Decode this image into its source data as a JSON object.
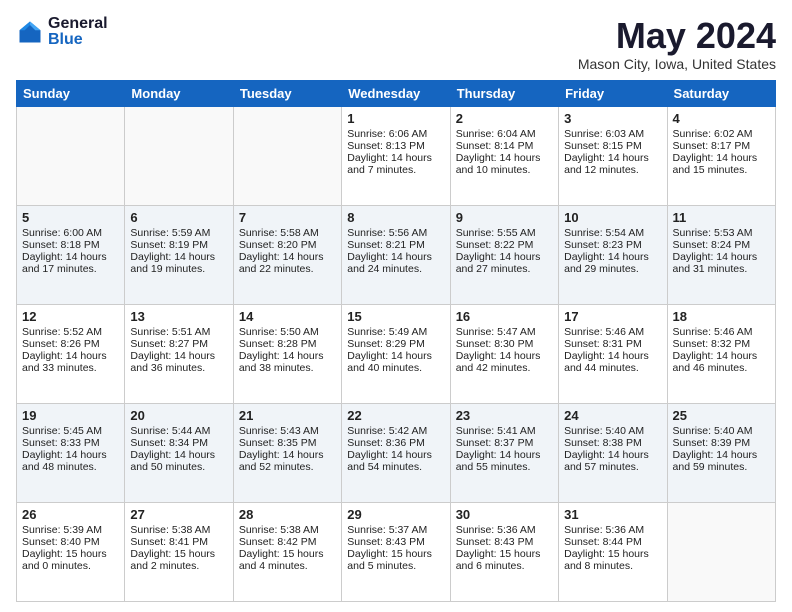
{
  "header": {
    "logo_general": "General",
    "logo_blue": "Blue",
    "title": "May 2024",
    "location": "Mason City, Iowa, United States"
  },
  "days_of_week": [
    "Sunday",
    "Monday",
    "Tuesday",
    "Wednesday",
    "Thursday",
    "Friday",
    "Saturday"
  ],
  "weeks": [
    [
      {
        "day": "",
        "sunrise": "",
        "sunset": "",
        "daylight": "",
        "empty": true
      },
      {
        "day": "",
        "sunrise": "",
        "sunset": "",
        "daylight": "",
        "empty": true
      },
      {
        "day": "",
        "sunrise": "",
        "sunset": "",
        "daylight": "",
        "empty": true
      },
      {
        "day": "1",
        "sunrise": "Sunrise: 6:06 AM",
        "sunset": "Sunset: 8:13 PM",
        "daylight": "Daylight: 14 hours and 7 minutes."
      },
      {
        "day": "2",
        "sunrise": "Sunrise: 6:04 AM",
        "sunset": "Sunset: 8:14 PM",
        "daylight": "Daylight: 14 hours and 10 minutes."
      },
      {
        "day": "3",
        "sunrise": "Sunrise: 6:03 AM",
        "sunset": "Sunset: 8:15 PM",
        "daylight": "Daylight: 14 hours and 12 minutes."
      },
      {
        "day": "4",
        "sunrise": "Sunrise: 6:02 AM",
        "sunset": "Sunset: 8:17 PM",
        "daylight": "Daylight: 14 hours and 15 minutes."
      }
    ],
    [
      {
        "day": "5",
        "sunrise": "Sunrise: 6:00 AM",
        "sunset": "Sunset: 8:18 PM",
        "daylight": "Daylight: 14 hours and 17 minutes."
      },
      {
        "day": "6",
        "sunrise": "Sunrise: 5:59 AM",
        "sunset": "Sunset: 8:19 PM",
        "daylight": "Daylight: 14 hours and 19 minutes."
      },
      {
        "day": "7",
        "sunrise": "Sunrise: 5:58 AM",
        "sunset": "Sunset: 8:20 PM",
        "daylight": "Daylight: 14 hours and 22 minutes."
      },
      {
        "day": "8",
        "sunrise": "Sunrise: 5:56 AM",
        "sunset": "Sunset: 8:21 PM",
        "daylight": "Daylight: 14 hours and 24 minutes."
      },
      {
        "day": "9",
        "sunrise": "Sunrise: 5:55 AM",
        "sunset": "Sunset: 8:22 PM",
        "daylight": "Daylight: 14 hours and 27 minutes."
      },
      {
        "day": "10",
        "sunrise": "Sunrise: 5:54 AM",
        "sunset": "Sunset: 8:23 PM",
        "daylight": "Daylight: 14 hours and 29 minutes."
      },
      {
        "day": "11",
        "sunrise": "Sunrise: 5:53 AM",
        "sunset": "Sunset: 8:24 PM",
        "daylight": "Daylight: 14 hours and 31 minutes."
      }
    ],
    [
      {
        "day": "12",
        "sunrise": "Sunrise: 5:52 AM",
        "sunset": "Sunset: 8:26 PM",
        "daylight": "Daylight: 14 hours and 33 minutes."
      },
      {
        "day": "13",
        "sunrise": "Sunrise: 5:51 AM",
        "sunset": "Sunset: 8:27 PM",
        "daylight": "Daylight: 14 hours and 36 minutes."
      },
      {
        "day": "14",
        "sunrise": "Sunrise: 5:50 AM",
        "sunset": "Sunset: 8:28 PM",
        "daylight": "Daylight: 14 hours and 38 minutes."
      },
      {
        "day": "15",
        "sunrise": "Sunrise: 5:49 AM",
        "sunset": "Sunset: 8:29 PM",
        "daylight": "Daylight: 14 hours and 40 minutes."
      },
      {
        "day": "16",
        "sunrise": "Sunrise: 5:47 AM",
        "sunset": "Sunset: 8:30 PM",
        "daylight": "Daylight: 14 hours and 42 minutes."
      },
      {
        "day": "17",
        "sunrise": "Sunrise: 5:46 AM",
        "sunset": "Sunset: 8:31 PM",
        "daylight": "Daylight: 14 hours and 44 minutes."
      },
      {
        "day": "18",
        "sunrise": "Sunrise: 5:46 AM",
        "sunset": "Sunset: 8:32 PM",
        "daylight": "Daylight: 14 hours and 46 minutes."
      }
    ],
    [
      {
        "day": "19",
        "sunrise": "Sunrise: 5:45 AM",
        "sunset": "Sunset: 8:33 PM",
        "daylight": "Daylight: 14 hours and 48 minutes."
      },
      {
        "day": "20",
        "sunrise": "Sunrise: 5:44 AM",
        "sunset": "Sunset: 8:34 PM",
        "daylight": "Daylight: 14 hours and 50 minutes."
      },
      {
        "day": "21",
        "sunrise": "Sunrise: 5:43 AM",
        "sunset": "Sunset: 8:35 PM",
        "daylight": "Daylight: 14 hours and 52 minutes."
      },
      {
        "day": "22",
        "sunrise": "Sunrise: 5:42 AM",
        "sunset": "Sunset: 8:36 PM",
        "daylight": "Daylight: 14 hours and 54 minutes."
      },
      {
        "day": "23",
        "sunrise": "Sunrise: 5:41 AM",
        "sunset": "Sunset: 8:37 PM",
        "daylight": "Daylight: 14 hours and 55 minutes."
      },
      {
        "day": "24",
        "sunrise": "Sunrise: 5:40 AM",
        "sunset": "Sunset: 8:38 PM",
        "daylight": "Daylight: 14 hours and 57 minutes."
      },
      {
        "day": "25",
        "sunrise": "Sunrise: 5:40 AM",
        "sunset": "Sunset: 8:39 PM",
        "daylight": "Daylight: 14 hours and 59 minutes."
      }
    ],
    [
      {
        "day": "26",
        "sunrise": "Sunrise: 5:39 AM",
        "sunset": "Sunset: 8:40 PM",
        "daylight": "Daylight: 15 hours and 0 minutes."
      },
      {
        "day": "27",
        "sunrise": "Sunrise: 5:38 AM",
        "sunset": "Sunset: 8:41 PM",
        "daylight": "Daylight: 15 hours and 2 minutes."
      },
      {
        "day": "28",
        "sunrise": "Sunrise: 5:38 AM",
        "sunset": "Sunset: 8:42 PM",
        "daylight": "Daylight: 15 hours and 4 minutes."
      },
      {
        "day": "29",
        "sunrise": "Sunrise: 5:37 AM",
        "sunset": "Sunset: 8:43 PM",
        "daylight": "Daylight: 15 hours and 5 minutes."
      },
      {
        "day": "30",
        "sunrise": "Sunrise: 5:36 AM",
        "sunset": "Sunset: 8:43 PM",
        "daylight": "Daylight: 15 hours and 6 minutes."
      },
      {
        "day": "31",
        "sunrise": "Sunrise: 5:36 AM",
        "sunset": "Sunset: 8:44 PM",
        "daylight": "Daylight: 15 hours and 8 minutes."
      },
      {
        "day": "",
        "sunrise": "",
        "sunset": "",
        "daylight": "",
        "empty": true
      }
    ]
  ]
}
